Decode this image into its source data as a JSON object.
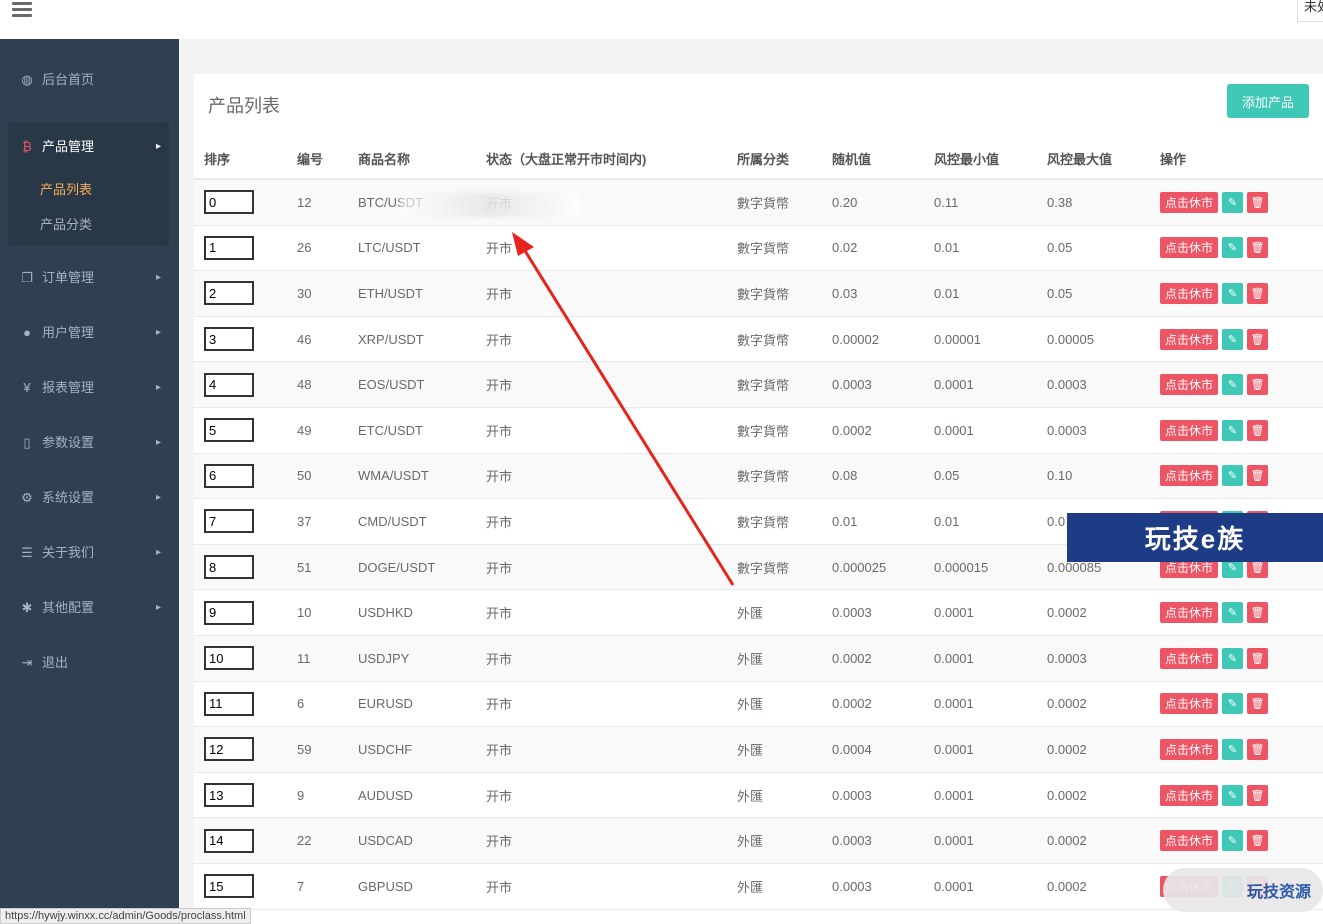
{
  "header": {
    "user_label": "未处"
  },
  "sidebar": {
    "items": [
      {
        "icon": "dashboard-icon",
        "glyph": "◍",
        "label": "后台首页",
        "arrow": false
      },
      {
        "icon": "bitcoin-icon",
        "glyph": "₿",
        "label": "产品管理",
        "arrow": true,
        "active": true,
        "children": [
          {
            "label": "产品列表",
            "active": true
          },
          {
            "label": "产品分类",
            "active": false
          }
        ]
      },
      {
        "icon": "copy-icon",
        "glyph": "❐",
        "label": "订单管理",
        "arrow": true
      },
      {
        "icon": "user-icon",
        "glyph": "●",
        "label": "用户管理",
        "arrow": true
      },
      {
        "icon": "yen-icon",
        "glyph": "¥",
        "label": "报表管理",
        "arrow": true
      },
      {
        "icon": "file-icon",
        "glyph": "▯",
        "label": "参数设置",
        "arrow": true
      },
      {
        "icon": "gears-icon",
        "glyph": "⚙",
        "label": "系统设置",
        "arrow": true
      },
      {
        "icon": "list-icon",
        "glyph": "☰",
        "label": "关于我们",
        "arrow": true
      },
      {
        "icon": "gear-icon",
        "glyph": "✱",
        "label": "其他配置",
        "arrow": true
      },
      {
        "icon": "logout-icon",
        "glyph": "⇥",
        "label": "退出",
        "arrow": false
      }
    ]
  },
  "panel": {
    "title": "产品列表",
    "add_button": "添加产品"
  },
  "table": {
    "headers": {
      "sort": "排序",
      "id": "编号",
      "name": "商品名称",
      "status": "状态（大盘正常开市时间内)",
      "category": "所属分类",
      "random": "随机值",
      "risk_min": "风控最小值",
      "risk_max": "风控最大值",
      "ops": "操作"
    },
    "close_label": "点击休市",
    "rows": [
      {
        "sort": "0",
        "id": "12",
        "name": "BTC/USDT",
        "status": "开市",
        "category": "數字貨幣",
        "random": "0.20",
        "min": "0.11",
        "max": "0.38"
      },
      {
        "sort": "1",
        "id": "26",
        "name": "LTC/USDT",
        "status": "开市",
        "category": "數字貨幣",
        "random": "0.02",
        "min": "0.01",
        "max": "0.05"
      },
      {
        "sort": "2",
        "id": "30",
        "name": "ETH/USDT",
        "status": "开市",
        "category": "數字貨幣",
        "random": "0.03",
        "min": "0.01",
        "max": "0.05"
      },
      {
        "sort": "3",
        "id": "46",
        "name": "XRP/USDT",
        "status": "开市",
        "category": "數字貨幣",
        "random": "0.00002",
        "min": "0.00001",
        "max": "0.00005"
      },
      {
        "sort": "4",
        "id": "48",
        "name": "EOS/USDT",
        "status": "开市",
        "category": "數字貨幣",
        "random": "0.0003",
        "min": "0.0001",
        "max": "0.0003"
      },
      {
        "sort": "5",
        "id": "49",
        "name": "ETC/USDT",
        "status": "开市",
        "category": "數字貨幣",
        "random": "0.0002",
        "min": "0.0001",
        "max": "0.0003"
      },
      {
        "sort": "6",
        "id": "50",
        "name": "WMA/USDT",
        "status": "开市",
        "category": "數字貨幣",
        "random": "0.08",
        "min": "0.05",
        "max": "0.10"
      },
      {
        "sort": "7",
        "id": "37",
        "name": "CMD/USDT",
        "status": "开市",
        "category": "數字貨幣",
        "random": "0.01",
        "min": "0.01",
        "max": "0.0"
      },
      {
        "sort": "8",
        "id": "51",
        "name": "DOGE/USDT",
        "status": "开市",
        "category": "數字貨幣",
        "random": "0.000025",
        "min": "0.000015",
        "max": "0.000085"
      },
      {
        "sort": "9",
        "id": "10",
        "name": "USDHKD",
        "status": "开市",
        "category": "外匯",
        "random": "0.0003",
        "min": "0.0001",
        "max": "0.0002"
      },
      {
        "sort": "10",
        "id": "11",
        "name": "USDJPY",
        "status": "开市",
        "category": "外匯",
        "random": "0.0002",
        "min": "0.0001",
        "max": "0.0003"
      },
      {
        "sort": "11",
        "id": "6",
        "name": "EURUSD",
        "status": "开市",
        "category": "外匯",
        "random": "0.0002",
        "min": "0.0001",
        "max": "0.0002"
      },
      {
        "sort": "12",
        "id": "59",
        "name": "USDCHF",
        "status": "开市",
        "category": "外匯",
        "random": "0.0004",
        "min": "0.0001",
        "max": "0.0002"
      },
      {
        "sort": "13",
        "id": "9",
        "name": "AUDUSD",
        "status": "开市",
        "category": "外匯",
        "random": "0.0003",
        "min": "0.0001",
        "max": "0.0002"
      },
      {
        "sort": "14",
        "id": "22",
        "name": "USDCAD",
        "status": "开市",
        "category": "外匯",
        "random": "0.0003",
        "min": "0.0001",
        "max": "0.0002"
      },
      {
        "sort": "15",
        "id": "7",
        "name": "GBPUSD",
        "status": "开市",
        "category": "外匯",
        "random": "0.0003",
        "min": "0.0001",
        "max": "0.0002"
      }
    ]
  },
  "overlays": {
    "watermark_text": "玩技e族",
    "watermark_small": "玩技资源",
    "status_url": "https://hywjy.winxx.cc/admin/Goods/proclass.html"
  },
  "colors": {
    "sidebar_bg": "#2f4050",
    "accent_teal": "#3fc8b5",
    "danger_red": "#ed5565",
    "active_sub": "#f8ac59",
    "arrow_red": "#e8231e"
  }
}
